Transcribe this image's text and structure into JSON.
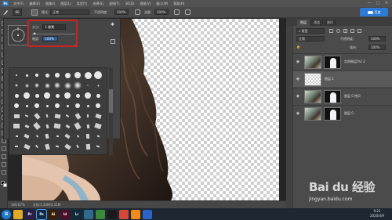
{
  "app": {
    "logo": "Ps"
  },
  "menubar": {
    "items": [
      "文件(F)",
      "编辑(E)",
      "图像(I)",
      "图层(L)",
      "类型(Y)",
      "选择(S)",
      "滤镜(T)",
      "3D(D)",
      "视图(V)",
      "窗口(W)",
      "帮助(H)"
    ]
  },
  "window_controls": {
    "minimize": "—",
    "maximize": "□",
    "close": "✕"
  },
  "options_bar": {
    "brush_size": "60",
    "mode_label": "模式:",
    "mode_value": "正常",
    "opacity_label": "不透明度:",
    "opacity_value": "100%",
    "flow_label": "流量:",
    "flow_value": "100%"
  },
  "baidu_badge": {
    "text": "百度"
  },
  "brush_picker": {
    "size_label": "大小:",
    "size_value": "1 像素",
    "hardness_label": "硬度:",
    "hardness_value": "100%",
    "size_slider_fraction": 0.05,
    "hardness_slider_fraction": 1.0
  },
  "status_bar": {
    "zoom": "106.67%",
    "doc": "文档:1.20M/4.31M"
  },
  "panels": {
    "tabs": [
      "图层",
      "通道",
      "路径"
    ],
    "blend_mode": "正常",
    "opacity_label": "不透明度:",
    "opacity_value": "100%",
    "fill_label": "填充:",
    "fill_value": "100%"
  },
  "layers": [
    {
      "name": "实例图层(%) 2",
      "thumb": "photo",
      "mask": true,
      "visible": true
    },
    {
      "name": "图层 1",
      "thumb": "check",
      "mask": false,
      "visible": true
    },
    {
      "name": "图层 0 拷贝",
      "thumb": "photo",
      "mask": true,
      "visible": true
    },
    {
      "name": "图层 0",
      "thumb": "photo",
      "mask": true,
      "visible": true
    }
  ],
  "taskbar": {
    "apps": [
      {
        "name": "file-explorer",
        "label": "",
        "color": "#e0a92a"
      },
      {
        "name": "premiere",
        "label": "Pr",
        "color": "#2a1f4a"
      },
      {
        "name": "photoshop",
        "label": "Ps",
        "color": "#0e2a47"
      },
      {
        "name": "illustrator",
        "label": "Ai",
        "color": "#3b1e05"
      },
      {
        "name": "indesign",
        "label": "Id",
        "color": "#4a0d2a"
      },
      {
        "name": "lightroom",
        "label": "Lr",
        "color": "#0f2a3a"
      },
      {
        "name": "media-player",
        "label": "",
        "color": "#2e6b8f"
      },
      {
        "name": "color-app",
        "label": "",
        "color": "#3a8a3a"
      },
      {
        "name": "qq",
        "label": "",
        "color": "#1a1a1a"
      },
      {
        "name": "chrome",
        "label": "",
        "color": "#d4483b"
      },
      {
        "name": "browser",
        "label": "",
        "color": "#f08a1a"
      },
      {
        "name": "app-blue",
        "label": "",
        "color": "#2d62c8"
      }
    ],
    "time": "9:21",
    "date": "2020/4/9"
  },
  "watermark": {
    "brand": "Bai du 经验",
    "url": "jingyan.baidu.com"
  }
}
